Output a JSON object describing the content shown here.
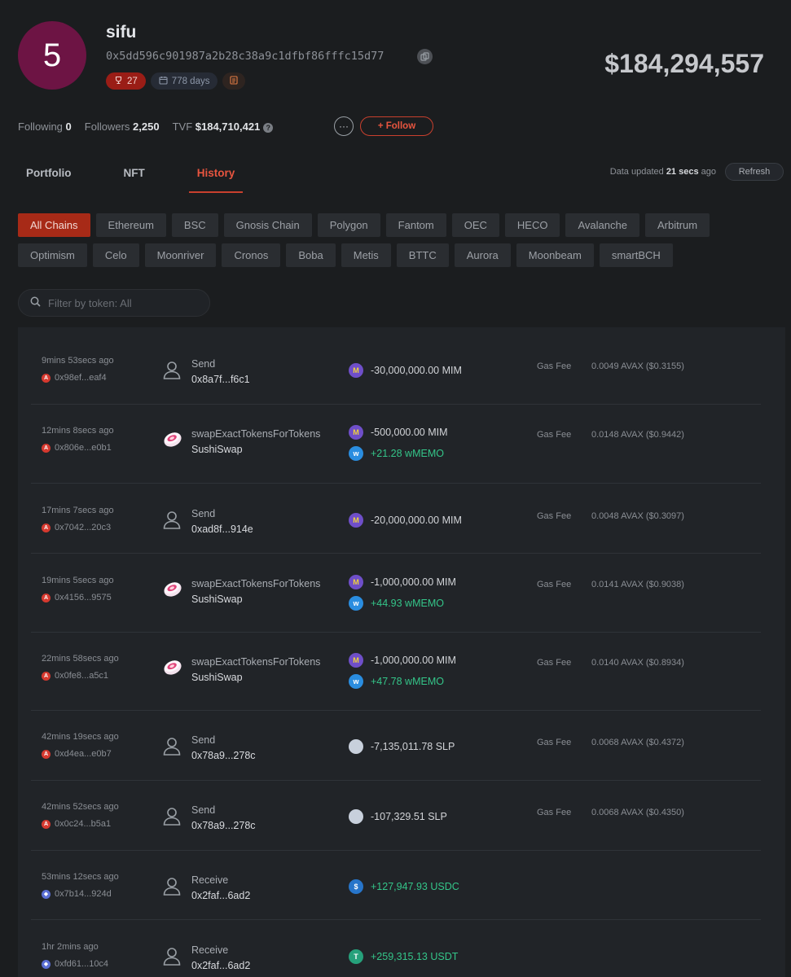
{
  "profile": {
    "avatar_text": "5",
    "name": "sifu",
    "address": "0x5dd596c901987a2b28c38a9c1dfbf86fffc15d77",
    "rank": "27",
    "days": "778 days",
    "net_worth": "$184,294,557"
  },
  "stats": {
    "following_label": "Following",
    "following": "0",
    "followers_label": "Followers",
    "followers": "2,250",
    "tvf_label": "TVF",
    "tvf": "$184,710,421"
  },
  "actions": {
    "more": "···",
    "follow": "+ Follow"
  },
  "tabs": [
    {
      "label": "Portfolio"
    },
    {
      "label": "NFT"
    },
    {
      "label": "History"
    }
  ],
  "update": {
    "prefix": "Data updated",
    "ago": "21 secs",
    "suffix": "ago",
    "refresh": "Refresh"
  },
  "chains": [
    "All Chains",
    "Ethereum",
    "BSC",
    "Gnosis Chain",
    "Polygon",
    "Fantom",
    "OEC",
    "HECO",
    "Avalanche",
    "Arbitrum",
    "Optimism",
    "Celo",
    "Moonriver",
    "Cronos",
    "Boba",
    "Metis",
    "BTTC",
    "Aurora",
    "Moonbeam",
    "smartBCH"
  ],
  "filter": {
    "placeholder": "Filter by token: All"
  },
  "gas_label": "Gas Fee",
  "transactions": [
    {
      "time": "9mins 53secs ago",
      "chain": "avax",
      "hash": "0x98ef...eaf4",
      "icon": "user-icon",
      "type": "Send",
      "target": "0x8a7f...f6c1",
      "tokens": [
        {
          "icon": "mim",
          "amount": "-30,000,000.00 MIM",
          "positive": false
        }
      ],
      "gas": "0.0049 AVAX ($0.3155)"
    },
    {
      "time": "12mins 8secs ago",
      "chain": "avax",
      "hash": "0x806e...e0b1",
      "icon": "sushiswap-icon",
      "type": "swapExactTokensForTokens",
      "target": "SushiSwap",
      "tokens": [
        {
          "icon": "mim",
          "amount": "-500,000.00 MIM",
          "positive": false
        },
        {
          "icon": "wmemo",
          "amount": "+21.28 wMEMO",
          "positive": true
        }
      ],
      "gas": "0.0148 AVAX ($0.9442)"
    },
    {
      "time": "17mins 7secs ago",
      "chain": "avax",
      "hash": "0x7042...20c3",
      "icon": "user-icon",
      "type": "Send",
      "target": "0xad8f...914e",
      "tokens": [
        {
          "icon": "mim",
          "amount": "-20,000,000.00 MIM",
          "positive": false
        }
      ],
      "gas": "0.0048 AVAX ($0.3097)"
    },
    {
      "time": "19mins 5secs ago",
      "chain": "avax",
      "hash": "0x4156...9575",
      "icon": "sushiswap-icon",
      "type": "swapExactTokensForTokens",
      "target": "SushiSwap",
      "tokens": [
        {
          "icon": "mim",
          "amount": "-1,000,000.00 MIM",
          "positive": false
        },
        {
          "icon": "wmemo",
          "amount": "+44.93 wMEMO",
          "positive": true
        }
      ],
      "gas": "0.0141 AVAX ($0.9038)"
    },
    {
      "time": "22mins 58secs ago",
      "chain": "avax",
      "hash": "0x0fe8...a5c1",
      "icon": "sushiswap-icon",
      "type": "swapExactTokensForTokens",
      "target": "SushiSwap",
      "tokens": [
        {
          "icon": "mim",
          "amount": "-1,000,000.00 MIM",
          "positive": false
        },
        {
          "icon": "wmemo",
          "amount": "+47.78 wMEMO",
          "positive": true
        }
      ],
      "gas": "0.0140 AVAX ($0.8934)"
    },
    {
      "time": "42mins 19secs ago",
      "chain": "avax",
      "hash": "0xd4ea...e0b7",
      "icon": "user-icon",
      "type": "Send",
      "target": "0x78a9...278c",
      "tokens": [
        {
          "icon": "slp",
          "amount": "-7,135,011.78 SLP",
          "positive": false
        }
      ],
      "gas": "0.0068 AVAX ($0.4372)"
    },
    {
      "time": "42mins 52secs ago",
      "chain": "avax",
      "hash": "0x0c24...b5a1",
      "icon": "user-icon",
      "type": "Send",
      "target": "0x78a9...278c",
      "tokens": [
        {
          "icon": "slp",
          "amount": "-107,329.51 SLP",
          "positive": false
        }
      ],
      "gas": "0.0068 AVAX ($0.4350)"
    },
    {
      "time": "53mins 12secs ago",
      "chain": "eth",
      "hash": "0x7b14...924d",
      "icon": "user-icon",
      "type": "Receive",
      "target": "0x2faf...6ad2",
      "tokens": [
        {
          "icon": "usdc",
          "amount": "+127,947.93 USDC",
          "positive": true
        }
      ],
      "gas": ""
    },
    {
      "time": "1hr 2mins ago",
      "chain": "eth",
      "hash": "0xfd61...10c4",
      "icon": "user-icon",
      "type": "Receive",
      "target": "0x2faf...6ad2",
      "tokens": [
        {
          "icon": "usdt",
          "amount": "+259,315.13 USDT",
          "positive": true
        }
      ],
      "gas": ""
    }
  ]
}
